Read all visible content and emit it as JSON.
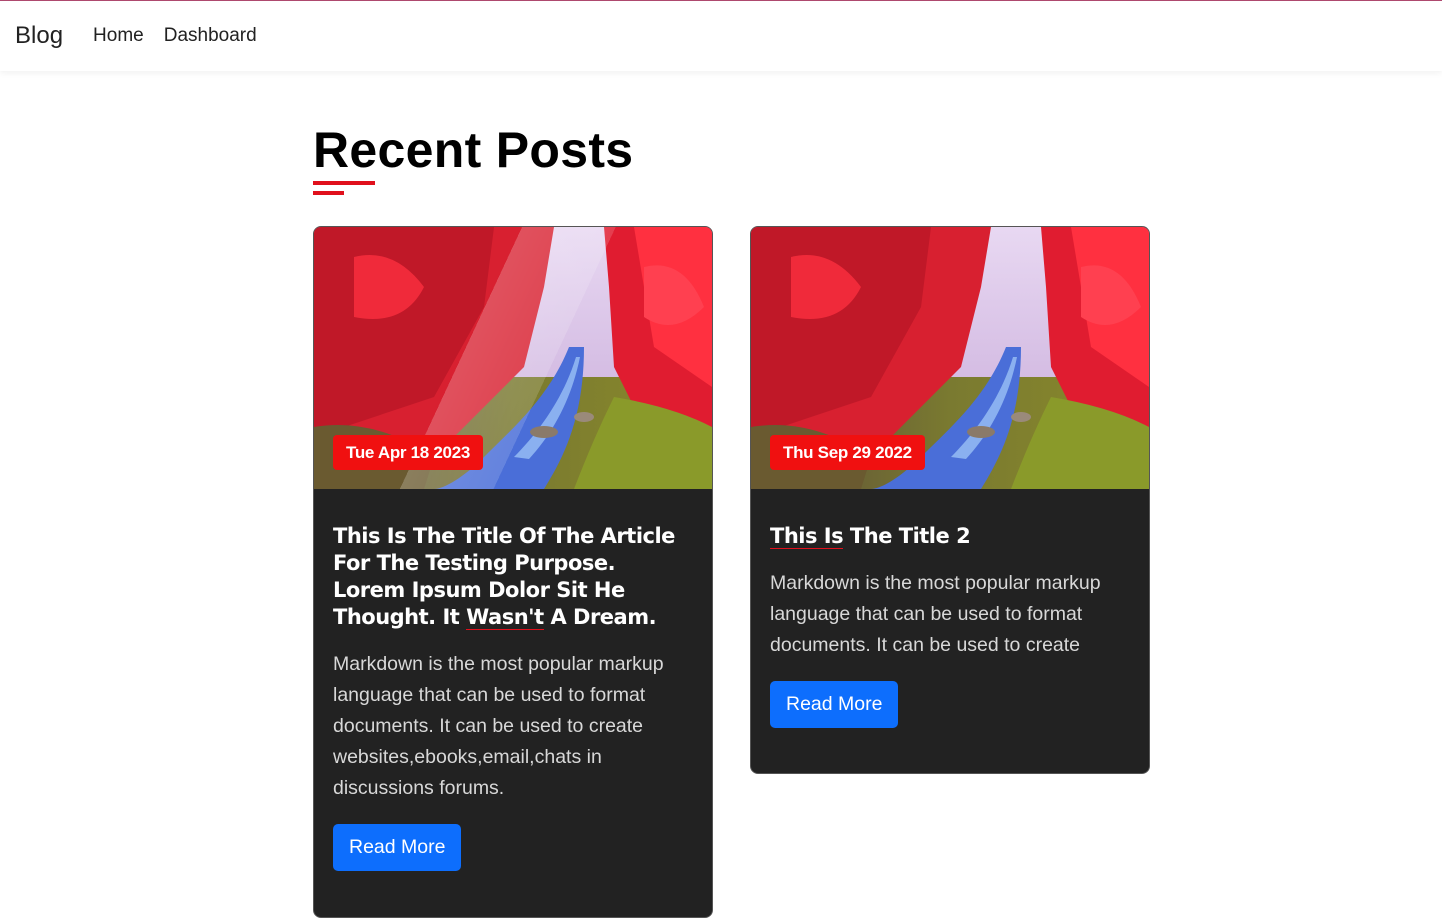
{
  "navbar": {
    "brand": "Blog",
    "links": [
      "Home",
      "Dashboard"
    ]
  },
  "page": {
    "title": "Recent Posts"
  },
  "posts": [
    {
      "date": "Tue Apr 18 2023",
      "title_first": "This Is The Title Of The Article For The Testing Purpose. Lorem Ipsum Dolor Sit He Thought. It ",
      "title_underlined": "Wasn't",
      "title_rest": " A Dream.",
      "excerpt": "Markdown is the most popular markup language that can be used to format documents. It can be used to create websites,ebooks,email,chats in discussions forums.",
      "button": "Read More"
    },
    {
      "date": "Thu Sep 29 2022",
      "title_first": "",
      "title_underlined": "This Is",
      "title_rest": " The Title 2",
      "excerpt": "Markdown is the most popular markup language that can be used to format documents. It can be used to create",
      "button": "Read More"
    }
  ],
  "colors": {
    "accent_red": "#e0101c",
    "button_blue": "#0d6efd",
    "card_bg": "#222222"
  }
}
